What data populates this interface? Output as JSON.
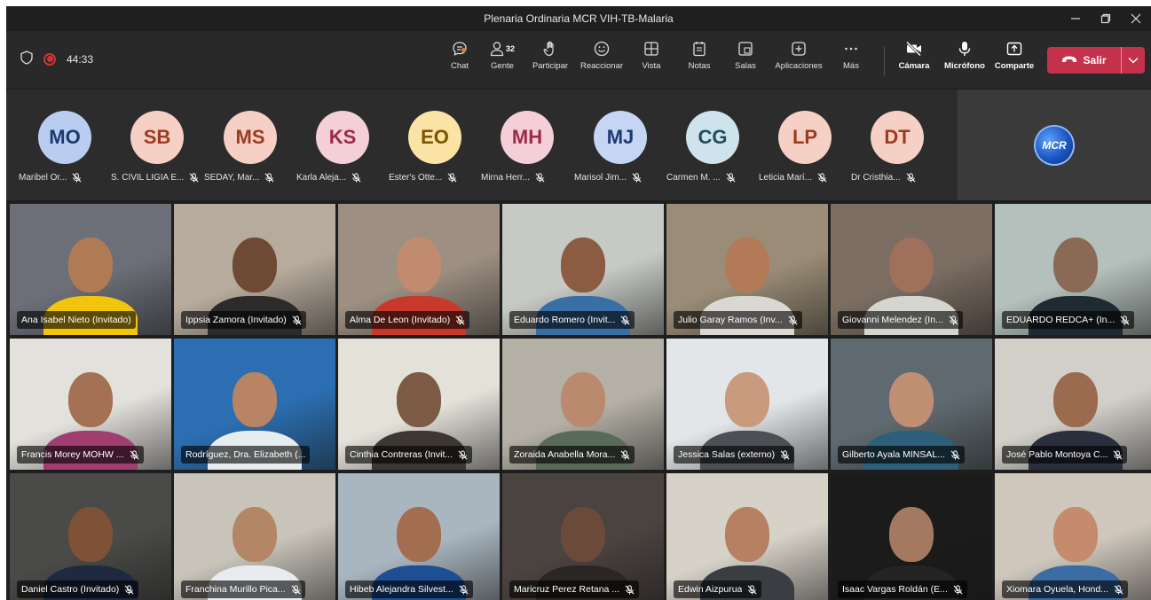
{
  "window": {
    "title": "Plenaria Ordinaria MCR VIH-TB-Malaria"
  },
  "meeting": {
    "timer": "44:33"
  },
  "toolbar": {
    "chat": "Chat",
    "people": "Gente",
    "people_count": "32",
    "raise": "Participar",
    "react": "Reaccionar",
    "view": "Vista",
    "notes": "Notas",
    "rooms": "Salas",
    "apps": "Aplicaciones",
    "more": "Más",
    "camera": "Cámara",
    "mic": "Micrófono",
    "share": "Comparte",
    "leave": "Salir"
  },
  "strip": [
    {
      "initials": "MO",
      "name": "Maribel Or...",
      "bg": "#b8cdf0",
      "fg": "#1d3a6e"
    },
    {
      "initials": "SB",
      "name": "S. CIVIL LIGIA E...",
      "bg": "#f6d0c4",
      "fg": "#9e3b1f"
    },
    {
      "initials": "MS",
      "name": "SEDAY, Mar...",
      "bg": "#f6d0c4",
      "fg": "#9e3b1f"
    },
    {
      "initials": "KS",
      "name": "Karla Aleja...",
      "bg": "#f5cfd8",
      "fg": "#9c2a47"
    },
    {
      "initials": "EO",
      "name": "Ester's Otte...",
      "bg": "#fbe3a5",
      "fg": "#7a5400"
    },
    {
      "initials": "MH",
      "name": "Mirna Herr...",
      "bg": "#f5cfd8",
      "fg": "#9c2a47"
    },
    {
      "initials": "MJ",
      "name": "Marisol Jim...",
      "bg": "#c5d6f4",
      "fg": "#1d3a6e"
    },
    {
      "initials": "CG",
      "name": "Carmen M. ...",
      "bg": "#cfe3ec",
      "fg": "#1e4d60"
    },
    {
      "initials": "LP",
      "name": "Leticia Marí...",
      "bg": "#f6d0c4",
      "fg": "#9e3b1f"
    },
    {
      "initials": "DT",
      "name": "Dr Cristhia...",
      "bg": "#f6d0c4",
      "fg": "#9e3b1f"
    }
  ],
  "overflow_logo": "MCR",
  "tiles": [
    {
      "name": "Ana Isabel Nieto (Invitado)",
      "mic": false,
      "bg": "#6d6f78",
      "shirt": "#f2c40c",
      "skin": "#b07a55"
    },
    {
      "name": "Ippsia Zamora (Invitado)",
      "mic": true,
      "bg": "#b7ab9d",
      "shirt": "#2d2a2a",
      "skin": "#6e4a35"
    },
    {
      "name": "Alma De Leon (Invitado)",
      "mic": true,
      "bg": "#9d8f82",
      "shirt": "#c73a2b",
      "skin": "#c18b6f"
    },
    {
      "name": "Eduardo Romero (Invit...",
      "mic": true,
      "bg": "#c6c9c4",
      "shirt": "#3a6fa6",
      "skin": "#8b5b42"
    },
    {
      "name": "Julio Garay Ramos (Inv...",
      "mic": true,
      "bg": "#9a8c76",
      "shirt": "#d9d8d2",
      "skin": "#b37a58"
    },
    {
      "name": "Giovanni Melendez (In...",
      "mic": true,
      "bg": "#7c6e63",
      "shirt": "#d6d4cf",
      "skin": "#a0715a"
    },
    {
      "name": "EDUARDO REDCA+ (In...",
      "mic": true,
      "bg": "#b4c0bb",
      "shirt": "#1f2a33",
      "skin": "#8a6a56"
    },
    {
      "name": "Francis Morey MOHW ...",
      "mic": true,
      "bg": "#e3e1dc",
      "shirt": "#a03e6f",
      "skin": "#a47155"
    },
    {
      "name": "Rodríguez, Dra. Elizabeth (...",
      "mic": false,
      "bg": "#2b6fb2",
      "shirt": "#e7ecef",
      "skin": "#b88464"
    },
    {
      "name": "Cinthia Contreras (Invit...",
      "mic": true,
      "bg": "#e4e1d9",
      "shirt": "#3d3733",
      "skin": "#7c5a44"
    },
    {
      "name": "Zoraida Anabella Mora...",
      "mic": true,
      "bg": "#b4b0a6",
      "shirt": "#5a6a58",
      "skin": "#b98a6d"
    },
    {
      "name": "Jessica Salas (externo)",
      "mic": true,
      "bg": "#e3e6e8",
      "shirt": "#4d4f55",
      "skin": "#c99a7d"
    },
    {
      "name": "Gilberto Ayala MINSAL...",
      "mic": true,
      "bg": "#5f6a70",
      "shirt": "#2d5f7a",
      "skin": "#c08e72"
    },
    {
      "name": "José Pablo Montoya C...",
      "mic": true,
      "bg": "#d2cfc9",
      "shirt": "#2a2f3d",
      "skin": "#9a6b4f"
    },
    {
      "name": "Daniel Castro (Invitado)",
      "mic": true,
      "bg": "#4a4a48",
      "shirt": "#1e2a40",
      "skin": "#7e5236"
    },
    {
      "name": "Franchina Murillo Pica...",
      "mic": true,
      "bg": "#c9c4ba",
      "shirt": "#e8ebef",
      "skin": "#b38665"
    },
    {
      "name": "Hibeb Alejandra Silvest...",
      "mic": true,
      "bg": "#a9b6c0",
      "shirt": "#1e4e93",
      "skin": "#a36d4f"
    },
    {
      "name": "Maricruz Perez Retana ...",
      "mic": true,
      "bg": "#4b4340",
      "shirt": "#2a2624",
      "skin": "#6c4a3a"
    },
    {
      "name": "Edwin Aizpurua",
      "mic": true,
      "bg": "#d7d2c8",
      "shirt": "#3a3d42",
      "skin": "#b78063"
    },
    {
      "name": "Isaac Vargas Roldán (E...",
      "mic": true,
      "bg": "#1b1b1b",
      "shirt": "#242424",
      "skin": "#a37a60"
    },
    {
      "name": "Xiomara Oyuela, Hond...",
      "mic": true,
      "bg": "#cfc7bc",
      "shirt": "#3b6ca3",
      "skin": "#c48b6c"
    }
  ]
}
